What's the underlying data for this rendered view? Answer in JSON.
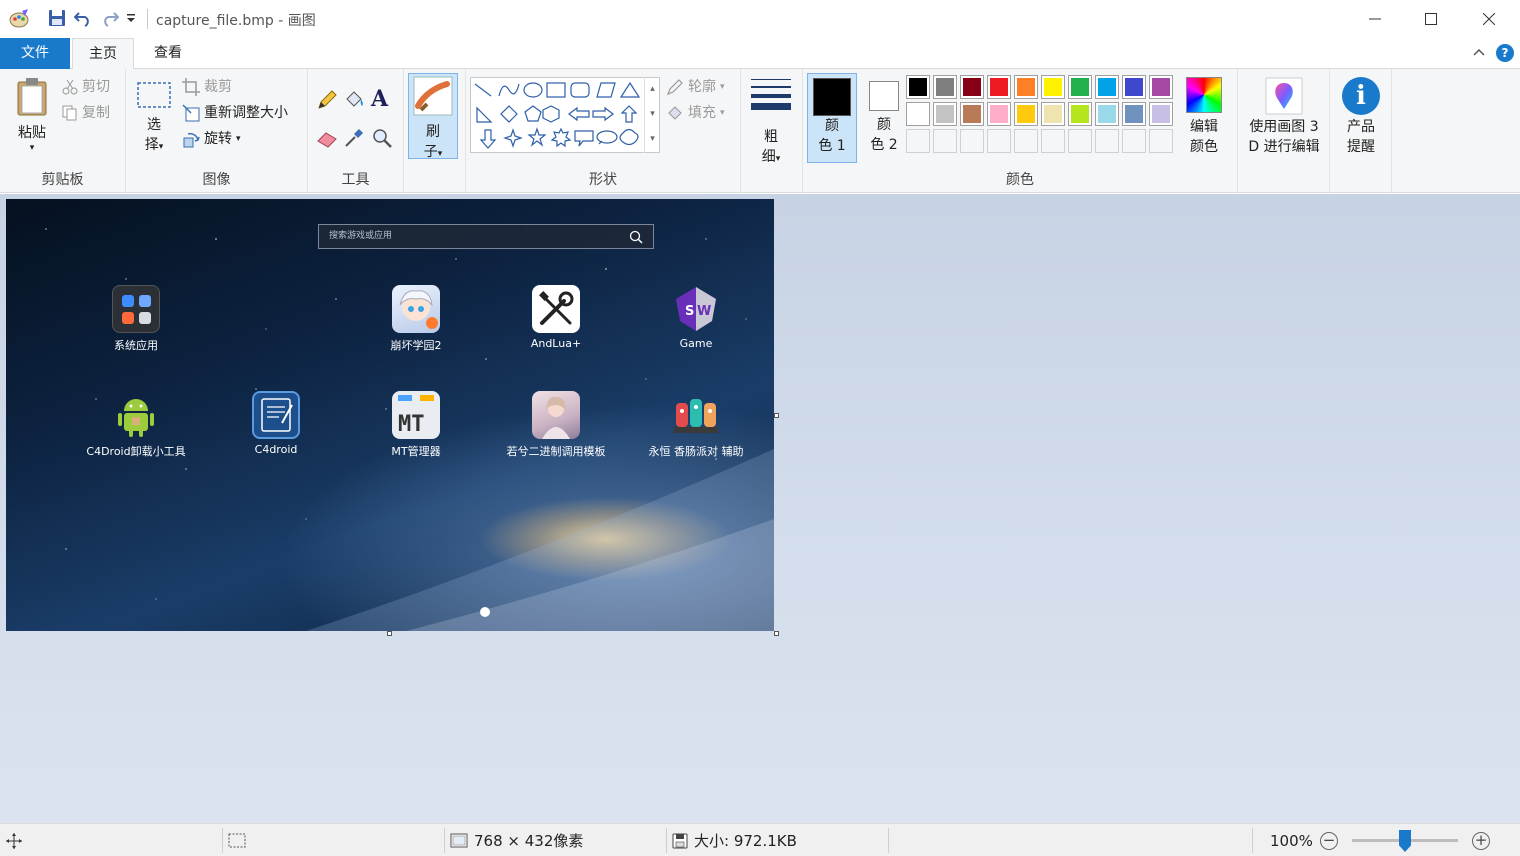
{
  "window": {
    "title": "capture_file.bmp - 画图",
    "colors": {
      "accent": "#1979ca",
      "ribbon_bg": "#f5f6f7"
    }
  },
  "tabs": [
    {
      "label": "文件",
      "selected": false
    },
    {
      "label": "主页",
      "selected": true
    },
    {
      "label": "查看",
      "selected": false
    }
  ],
  "ribbon": {
    "clipboard": {
      "label": "剪贴板",
      "paste": "粘贴",
      "cut": "剪切",
      "copy": "复制"
    },
    "image": {
      "label": "图像",
      "select_1": "选",
      "select_2": "择",
      "crop": "裁剪",
      "resize": "重新调整大小",
      "rotate": "旋转"
    },
    "tools": {
      "label": "工具",
      "text_glyph": "A"
    },
    "brushes": {
      "label_1": "刷",
      "label_2": "子"
    },
    "shapes": {
      "label": "形状",
      "outline": "轮廓",
      "fill": "填充"
    },
    "size": {
      "label_1": "粗",
      "label_2": "细"
    },
    "colors": {
      "label": "颜色",
      "color1_1": "颜",
      "color1_2": "色 1",
      "color2_1": "颜",
      "color2_2": "色 2",
      "edit_1": "编辑",
      "edit_2": "颜色",
      "color1_value": "#000000",
      "color2_value": "#ffffff",
      "palette_row1": [
        "#000000",
        "#7f7f7f",
        "#880015",
        "#ed1c24",
        "#ff7f27",
        "#fff200",
        "#22b14c",
        "#00a2e8",
        "#3f48cc",
        "#a349a4"
      ],
      "palette_row2": [
        "#ffffff",
        "#c3c3c3",
        "#b97a57",
        "#ffaec9",
        "#ffc90e",
        "#efe4b0",
        "#b5e61d",
        "#99d9ea",
        "#7092be",
        "#c8bfe7"
      ]
    },
    "paint3d": {
      "label_1": "使用画图 3",
      "label_2": "D 进行编辑"
    },
    "product_alert": {
      "label_1": "产品",
      "label_2": "提醒"
    }
  },
  "canvas": {
    "search_placeholder": "搜索游戏或应用",
    "apps": [
      {
        "label": "系统应用"
      },
      {
        "label": "崩坏学园2"
      },
      {
        "label": "AndLua+"
      },
      {
        "label": "Game"
      },
      {
        "label": "C4Droid卸载小工具"
      },
      {
        "label": "C4droid"
      },
      {
        "label": "MT管理器"
      },
      {
        "label": "若兮二进制调用模板"
      },
      {
        "label": "永恒 香肠派对 辅助"
      }
    ]
  },
  "status": {
    "dimensions": "768 × 432像素",
    "size": "大小: 972.1KB",
    "zoom": "100%"
  }
}
